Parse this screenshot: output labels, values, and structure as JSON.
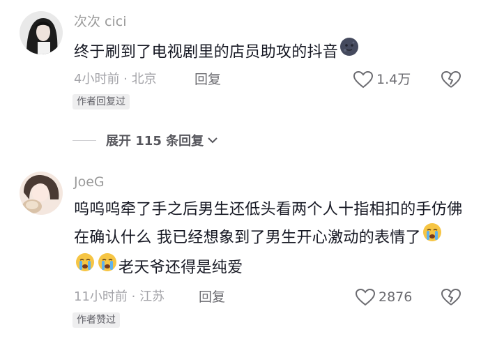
{
  "comments": [
    {
      "username": "次次 cici",
      "text": "终于刷到了电视剧里的店员助攻的抖音",
      "emoji": "moon-face",
      "time_location": "4小时前 · 北京",
      "reply_label": "回复",
      "likes": "1.4万",
      "badge": "作者回复过"
    },
    {
      "username": "JoeG",
      "text_parts": [
        "呜呜呜牵了手之后男生还低头看两个人十指相扣的手仿佛在确认什么 我已经想象到了男生开心激动的表情了",
        "老天爷还得是纯爱"
      ],
      "emoji": "crying-face",
      "time_location": "11小时前 · 江苏",
      "reply_label": "回复",
      "likes": "2876",
      "badge": "作者赞过"
    }
  ],
  "expand_replies": {
    "label": "展开 115 条回复"
  },
  "colors": {
    "text": "#161823",
    "meta": "#a3a3a8",
    "badge_bg": "#eeeeef"
  }
}
